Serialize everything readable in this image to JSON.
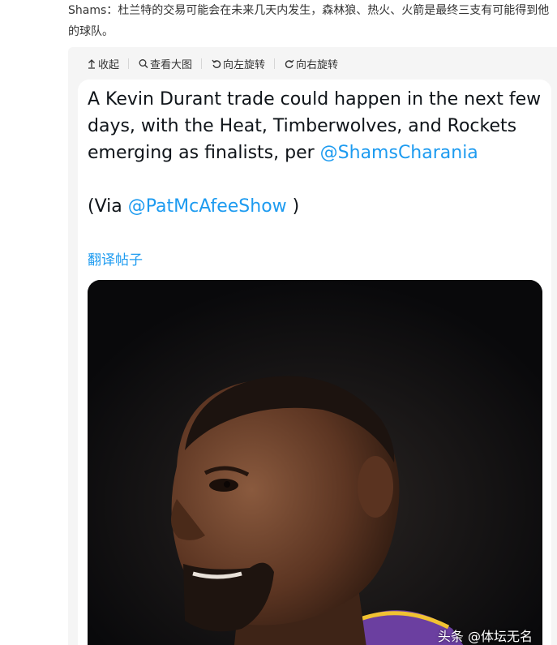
{
  "intro_text": "Shams：杜兰特的交易可能会在未来几天内发生，森林狼、热火、火箭是最终三支有可能得到他的球队。",
  "toolbar": {
    "collapse": "收起",
    "view_large": "查看大图",
    "rotate_left": "向左旋转",
    "rotate_right": "向右旋转"
  },
  "tweet": {
    "text": "A Kevin Durant trade could happen in the next few days, with the Heat, Timberwolves, and Rockets emerging as finalists, per ",
    "mention1": "@ShamsCharania",
    "via_open": "(Via ",
    "mention2": "@PatMcAfeeShow",
    "via_close": " )",
    "translate": "翻译帖子"
  },
  "watermark": "头条 @体坛无名",
  "colors": {
    "link": "#1d9bf0",
    "photo_bg": "#0b0b0d",
    "jersey": "#6b3fa0"
  },
  "icons": [
    "collapse-icon",
    "search-icon",
    "rotate-left-icon",
    "rotate-right-icon"
  ]
}
